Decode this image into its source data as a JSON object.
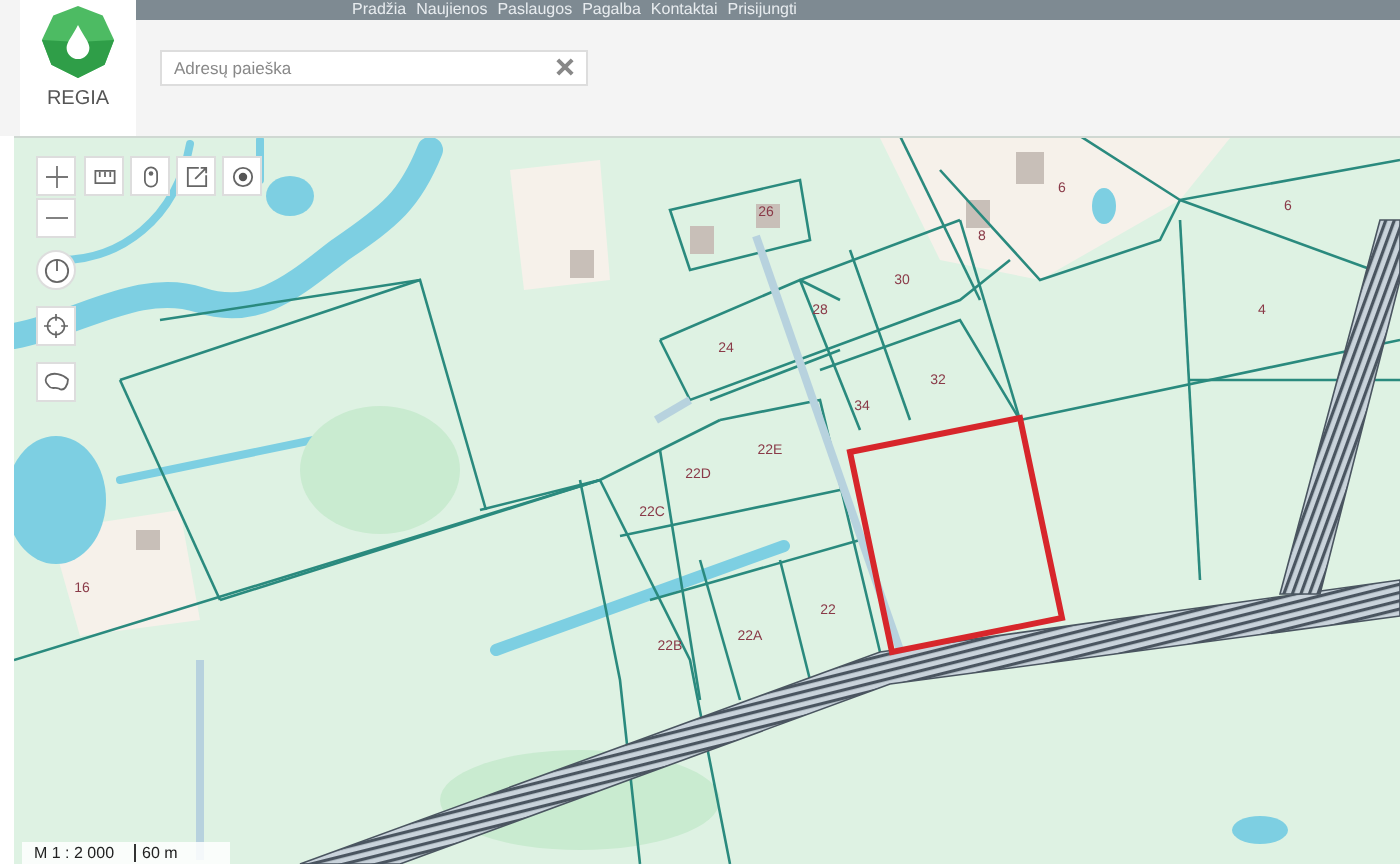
{
  "logo": {
    "text": "REGIA"
  },
  "nav": [
    {
      "label": "Pradžia"
    },
    {
      "label": "Naujienos"
    },
    {
      "label": "Paslaugos"
    },
    {
      "label": "Pagalba"
    },
    {
      "label": "Kontaktai"
    },
    {
      "label": "Prisijungti"
    }
  ],
  "search": {
    "placeholder": "Adresų paieška"
  },
  "map": {
    "parcel_labels": [
      "26",
      "6",
      "8",
      "6",
      "4",
      "30",
      "28",
      "24",
      "32",
      "34",
      "22E",
      "22D",
      "22C",
      "22",
      "22A",
      "22B",
      "16"
    ],
    "scale": {
      "ratio": "M 1 : 2 000",
      "distance": "60 m"
    }
  }
}
